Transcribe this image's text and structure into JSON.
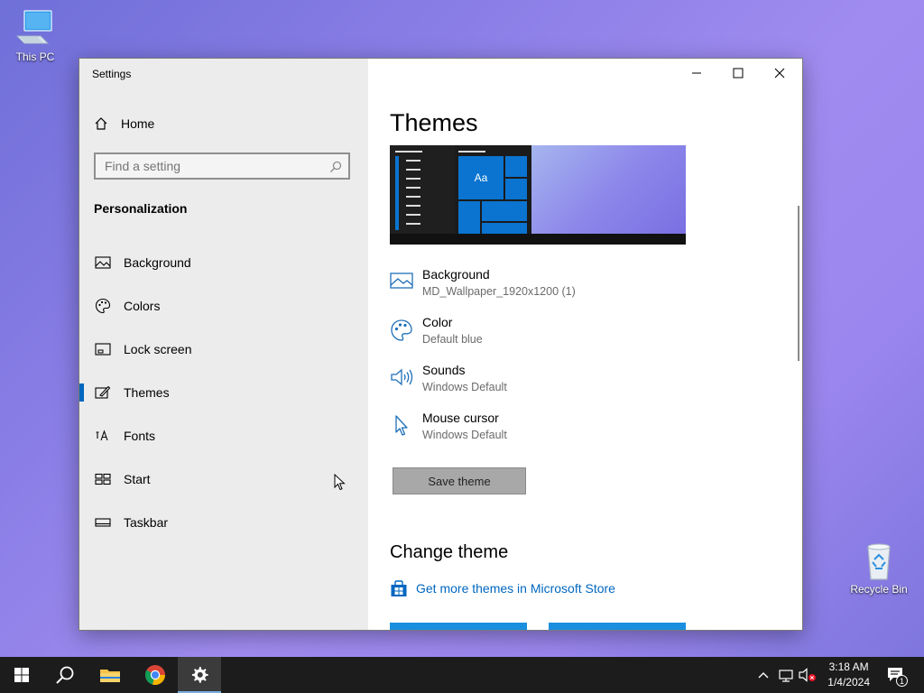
{
  "desktop": {
    "this_pc": "This PC",
    "recycle_bin": "Recycle Bin"
  },
  "window": {
    "title": "Settings",
    "minimize_icon": "minimize-icon",
    "maximize_icon": "maximize-icon",
    "close_icon": "close-icon"
  },
  "sidebar": {
    "home": "Home",
    "search_placeholder": "Find a setting",
    "section": "Personalization",
    "items": [
      {
        "label": "Background",
        "icon": "picture-icon"
      },
      {
        "label": "Colors",
        "icon": "palette-icon"
      },
      {
        "label": "Lock screen",
        "icon": "lock-screen-icon"
      },
      {
        "label": "Themes",
        "icon": "brush-icon",
        "selected": true
      },
      {
        "label": "Fonts",
        "icon": "font-icon"
      },
      {
        "label": "Start",
        "icon": "start-tiles-icon"
      },
      {
        "label": "Taskbar",
        "icon": "taskbar-icon"
      }
    ]
  },
  "main": {
    "title": "Themes",
    "preview_tile_text": "Aa",
    "properties": [
      {
        "label": "Background",
        "value": "MD_Wallpaper_1920x1200 (1)",
        "icon": "picture-icon"
      },
      {
        "label": "Color",
        "value": "Default blue",
        "icon": "palette-icon"
      },
      {
        "label": "Sounds",
        "value": "Windows Default",
        "icon": "speaker-icon"
      },
      {
        "label": "Mouse cursor",
        "value": "Windows Default",
        "icon": "cursor-icon"
      }
    ],
    "save_theme": "Save theme",
    "change_theme": "Change theme",
    "store_link": "Get more themes in Microsoft Store"
  },
  "taskbar": {
    "time": "3:18 AM",
    "date": "1/4/2024",
    "notification_count": "1"
  },
  "colors": {
    "accent": "#0067c0",
    "sidebar_bg": "#ececec",
    "taskbar_bg": "#1c1c1c"
  }
}
